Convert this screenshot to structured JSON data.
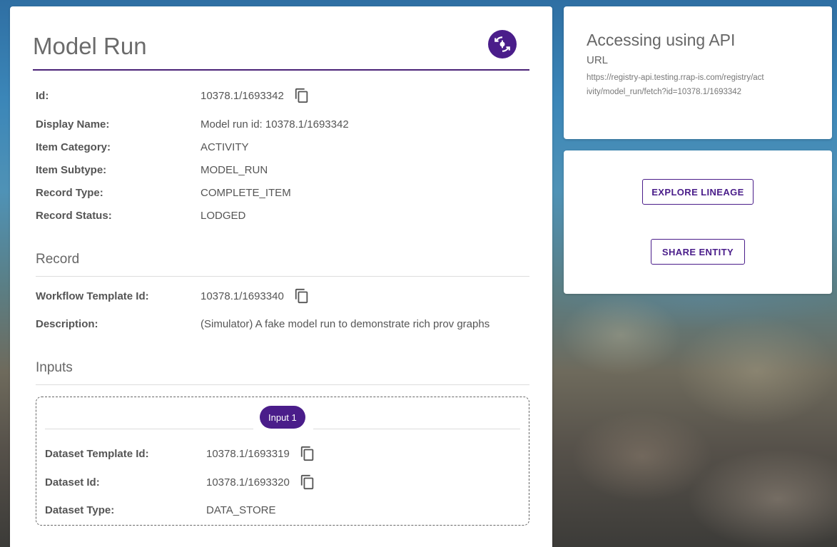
{
  "header": {
    "title": "Model Run",
    "refresh_icon": "lineage-refresh-icon"
  },
  "details": {
    "id": {
      "label": "Id:",
      "value": "10378.1/1693342"
    },
    "display_name": {
      "label": "Display Name:",
      "value": "Model run id: 10378.1/1693342"
    },
    "item_category": {
      "label": "Item Category:",
      "value": "ACTIVITY"
    },
    "item_subtype": {
      "label": "Item Subtype:",
      "value": "MODEL_RUN"
    },
    "record_type": {
      "label": "Record Type:",
      "value": "COMPLETE_ITEM"
    },
    "record_status": {
      "label": "Record Status:",
      "value": "LODGED"
    }
  },
  "record": {
    "title": "Record",
    "workflow_template_id": {
      "label": "Workflow Template Id:",
      "value": "10378.1/1693340"
    },
    "description": {
      "label": "Description:",
      "value": "(Simulator) A fake model run to demonstrate rich prov graphs"
    }
  },
  "inputs": {
    "title": "Inputs",
    "items": [
      {
        "chip": "Input 1",
        "dataset_template_id": {
          "label": "Dataset Template Id:",
          "value": "10378.1/1693319"
        },
        "dataset_id": {
          "label": "Dataset Id:",
          "value": "10378.1/1693320"
        },
        "dataset_type": {
          "label": "Dataset Type:",
          "value": "DATA_STORE"
        }
      }
    ]
  },
  "api": {
    "title": "Accessing using API",
    "url_label": "URL",
    "url": "https://registry-api.testing.rrap-is.com/registry/activity/model_run/fetch?id=10378.1/1693342"
  },
  "actions": {
    "explore_lineage": "EXPLORE LINEAGE",
    "share_entity": "SHARE ENTITY"
  },
  "colors": {
    "accent": "#4a1d8a",
    "title_underline": "#4a2277"
  }
}
